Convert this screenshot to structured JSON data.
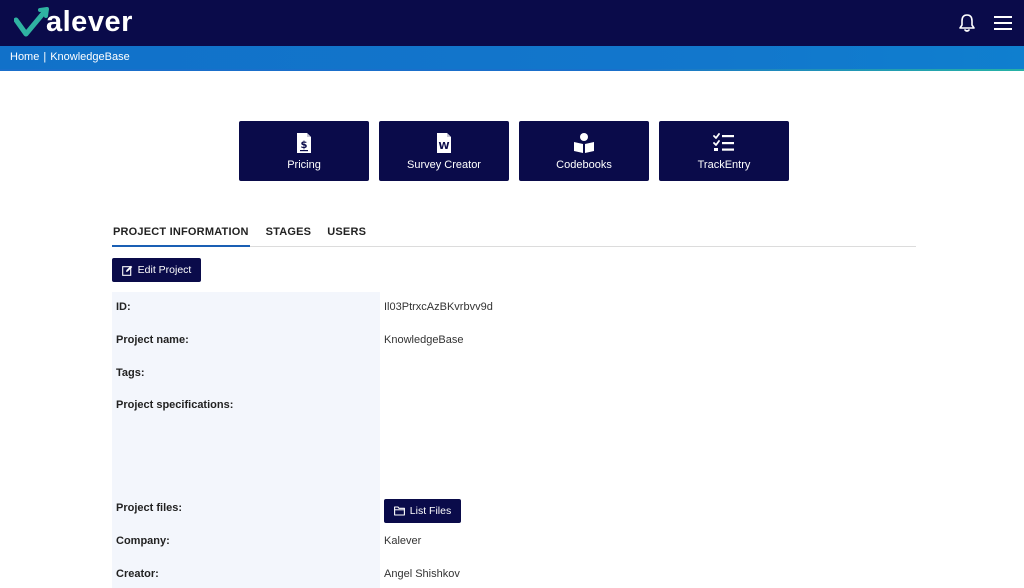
{
  "header": {
    "logo_text": "alever",
    "logo_mark_color": "#2fb3a2",
    "icons": [
      "bell-icon",
      "hamburger-menu-icon"
    ]
  },
  "breadcrumb": {
    "home": "Home",
    "separator": "|",
    "current": "KnowledgeBase"
  },
  "tiles": [
    {
      "label": "Pricing",
      "icon": "invoice-dollar-icon"
    },
    {
      "label": "Survey Creator",
      "icon": "word-document-icon"
    },
    {
      "label": "Codebooks",
      "icon": "reader-book-icon"
    },
    {
      "label": "TrackEntry",
      "icon": "checklist-icon"
    }
  ],
  "tabs": [
    {
      "label": "PROJECT INFORMATION",
      "active": true
    },
    {
      "label": "STAGES",
      "active": false
    },
    {
      "label": "USERS",
      "active": false
    }
  ],
  "edit_button": {
    "label": "Edit Project",
    "icon": "edit-icon"
  },
  "project": {
    "id_label": "ID:",
    "id_value": "Il03PtrxcAzBKvrbvv9d",
    "name_label": "Project name:",
    "name_value": "KnowledgeBase",
    "tags_label": "Tags:",
    "specs_label": "Project specifications:",
    "files_label": "Project files:",
    "list_files_label": "List Files",
    "company_label": "Company:",
    "company_value": "Kalever",
    "creator_label": "Creator:",
    "creator_value": "Angel Shishkov"
  },
  "colors": {
    "navy": "#0a0b4a",
    "breadcrumb_blue": "#1277cc",
    "label_bg": "#f3f6fc",
    "tab_underline": "#1a5fb4"
  }
}
